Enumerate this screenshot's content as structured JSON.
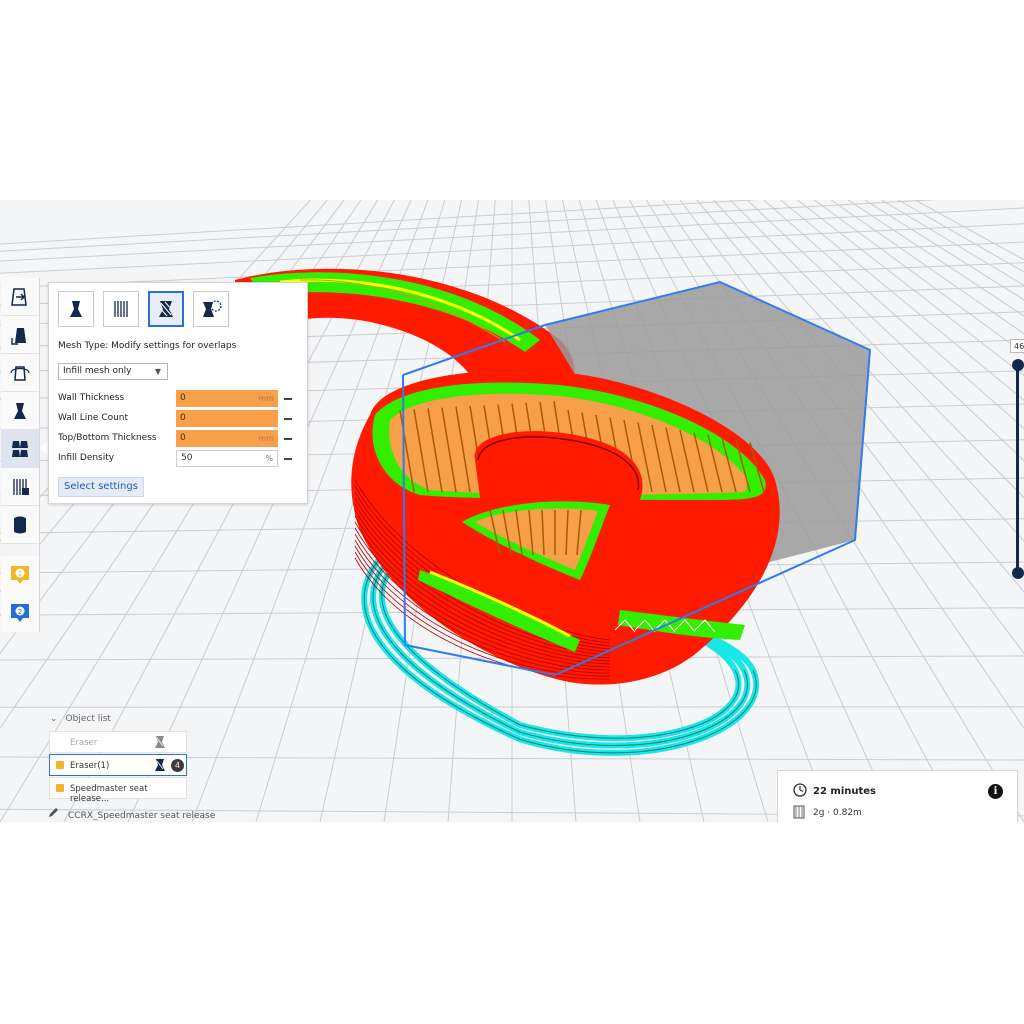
{
  "mesh_types": [
    {
      "icon": "normal-model-icon",
      "selected": false
    },
    {
      "icon": "support-mesh-icon",
      "selected": false
    },
    {
      "icon": "infill-mesh-overlap-icon",
      "selected": true
    },
    {
      "icon": "support-blocker-icon",
      "selected": false
    }
  ],
  "panel": {
    "mesh_type_label": "Mesh Type: Modify settings for overlaps",
    "dropdown_value": "Infill mesh only",
    "settings": [
      {
        "label": "Wall Thickness",
        "value": "0",
        "unit": "mm",
        "style": "orange"
      },
      {
        "label": "Wall Line Count",
        "value": "0",
        "unit": "",
        "style": "orange"
      },
      {
        "label": "Top/Bottom Thickness",
        "value": "0",
        "unit": "mm",
        "style": "orange"
      },
      {
        "label": "Infill Density",
        "value": "50",
        "unit": "%",
        "style": "plain"
      }
    ],
    "select_button": "Select settings"
  },
  "toolbar": {
    "tools": [
      "move-icon",
      "scale-icon",
      "rotate-icon",
      "mirror-icon",
      "per-model-settings-icon",
      "support-blocker-icon",
      "mesh-tools-icon"
    ],
    "active_tool": 4,
    "extensions": [
      {
        "icon": "marker-1-icon",
        "number": "1",
        "color": "#f3b62a"
      },
      {
        "icon": "marker-2-icon",
        "number": "2",
        "color": "#1f6fd6"
      }
    ]
  },
  "object_list": {
    "title": "Object list",
    "items": [
      {
        "name": "Eraser",
        "dim": true,
        "flag": false
      },
      {
        "name": "Eraser(1)",
        "dim": false,
        "flag": true,
        "selected": true,
        "count": "4"
      },
      {
        "name": "Speedmaster seat release...",
        "dim": false,
        "flag": true
      }
    ],
    "file_name": "CCRX_Speedmaster seat release"
  },
  "print_info": {
    "time": "22 minutes",
    "material": "2g · 0.82m"
  },
  "layer_view": {
    "current_layer": "46"
  },
  "colors": {
    "accent": "#2a6fdb",
    "wall_red": "#ff1a00",
    "infill_orange": "#f7a049",
    "skin_yellow": "#ffff00",
    "inner_green": "#33ee00",
    "skirt_cyan": "#19e6e6",
    "grid_bg": "#f4f5f7",
    "bbox_gray": "#9a9a9a"
  }
}
